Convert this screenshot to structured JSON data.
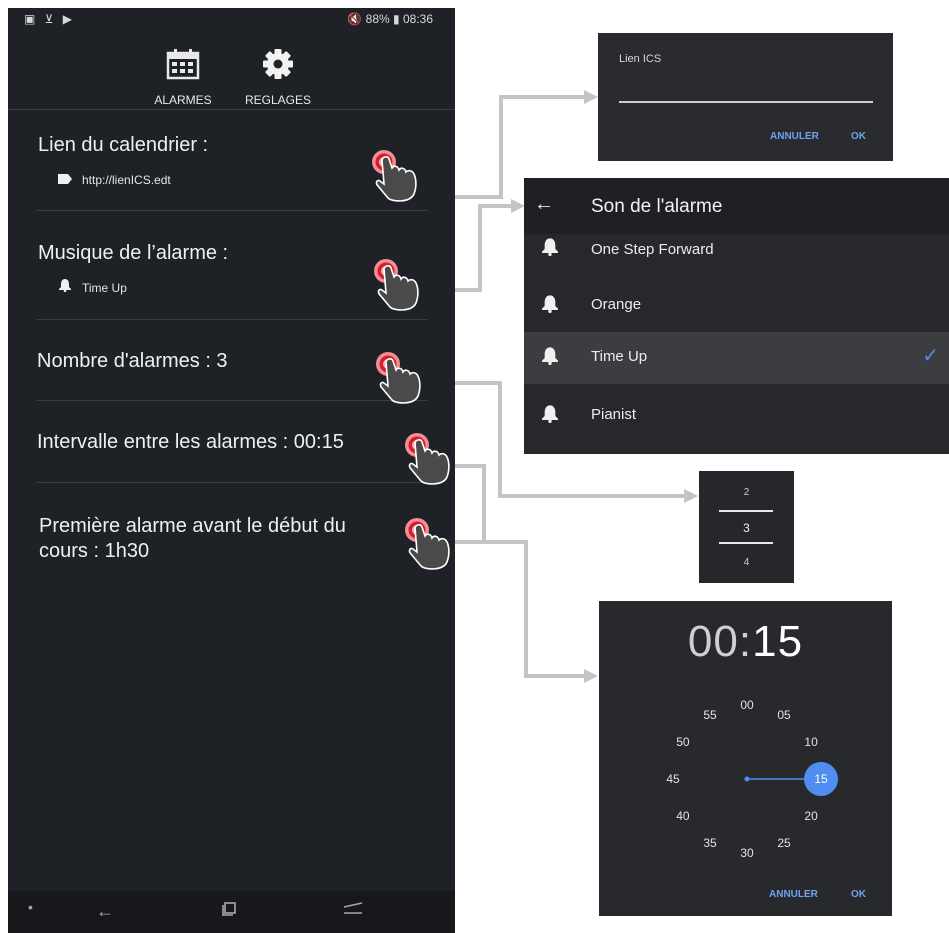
{
  "status_bar": {
    "left_icons": "▣ ⊻ ▶",
    "right": "🔇 88% ▮ 08:36"
  },
  "tabs": [
    {
      "label": "ALARMES",
      "icon": "calendar-icon"
    },
    {
      "label": "REGLAGES",
      "icon": "gear-icon"
    }
  ],
  "settings": {
    "calendar_link": {
      "title": "Lien du calendrier :",
      "value": "http://lienICS.edt",
      "icon": "label-tag-icon"
    },
    "alarm_music": {
      "title": "Musique de l’alarme :",
      "value": "Time Up",
      "icon": "bell-icon"
    },
    "alarm_count": {
      "title": "Nombre d'alarmes : 3"
    },
    "interval": {
      "title": "Intervalle entre les alarmes : 00:15"
    },
    "first_alarm": {
      "title": "Première alarme avant le début du cours : 1h30"
    }
  },
  "ics_dialog": {
    "label": "Lien ICS",
    "cancel": "ANNULER",
    "ok": "OK"
  },
  "sound_dialog": {
    "title": "Son de l'alarme",
    "items": [
      "One Step Forward",
      "Orange",
      "Time Up",
      "Pianist"
    ],
    "selected": "Time Up"
  },
  "number_picker": {
    "prev": "2",
    "current": "3",
    "next": "4"
  },
  "time_dialog": {
    "hours": "00",
    "separator": ":",
    "minutes": "15",
    "dial": [
      "00",
      "05",
      "10",
      "15",
      "20",
      "25",
      "30",
      "35",
      "40",
      "45",
      "50",
      "55"
    ],
    "selected_minute": "15",
    "cancel": "ANNULER",
    "ok": "OK"
  },
  "colors": {
    "phone_bg": "#1e2125",
    "accent": "#4f8ef0",
    "tap_red": "#d21f2a",
    "connector": "#c4c4c4"
  }
}
